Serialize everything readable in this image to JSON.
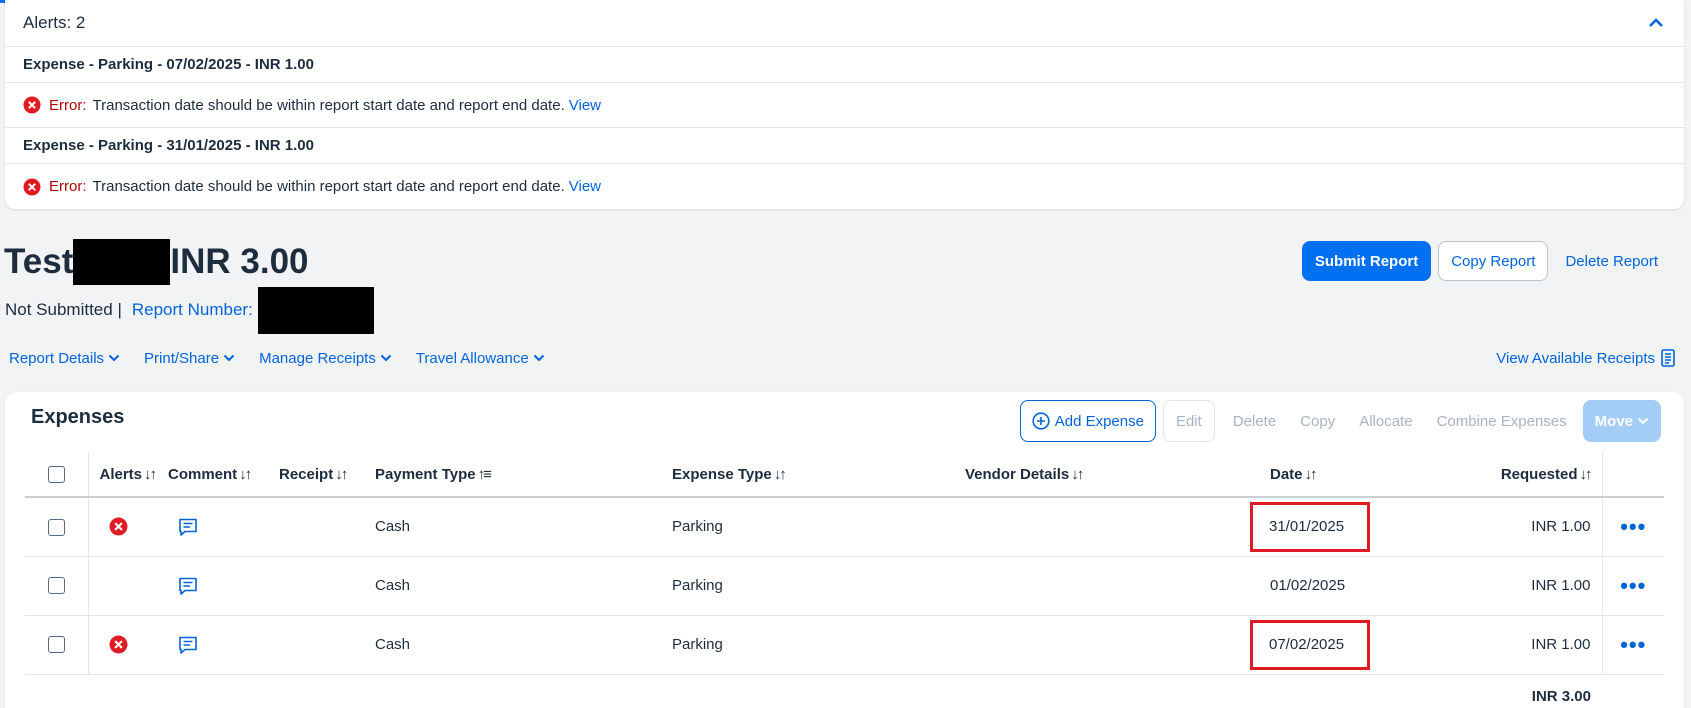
{
  "alerts": {
    "title": "Alerts: 2",
    "items": [
      {
        "expense": "Expense - Parking - 07/02/2025 - INR 1.00",
        "error_label": "Error:",
        "message": "Transaction date should be within report start date and report end date.",
        "link": "View"
      },
      {
        "expense": "Expense - Parking - 31/01/2025 - INR 1.00",
        "error_label": "Error:",
        "message": "Transaction date should be within report start date and report end date.",
        "link": "View"
      }
    ]
  },
  "report": {
    "title_prefix": "Test",
    "amount": "INR 3.00",
    "status": "Not Submitted |",
    "number_label": "Report Number:",
    "buttons": {
      "submit": "Submit Report",
      "copy": "Copy Report",
      "delete": "Delete Report"
    }
  },
  "menu": {
    "items": [
      "Report Details",
      "Print/Share",
      "Manage Receipts",
      "Travel Allowance"
    ],
    "view_receipts": "View Available Receipts"
  },
  "expenses": {
    "title": "Expenses",
    "toolbar": {
      "add": "Add Expense",
      "edit": "Edit",
      "delete": "Delete",
      "copy": "Copy",
      "allocate": "Allocate",
      "combine": "Combine Expenses",
      "move": "Move"
    },
    "columns": {
      "alerts": "Alerts",
      "comment": "Comment",
      "receipt": "Receipt",
      "payment_type": "Payment Type",
      "expense_type": "Expense Type",
      "vendor": "Vendor Details",
      "date": "Date",
      "requested": "Requested"
    },
    "rows": [
      {
        "payment_type": "Cash",
        "expense_type": "Parking",
        "vendor": "",
        "date": "31/01/2025",
        "requested": "INR 1.00"
      },
      {
        "payment_type": "Cash",
        "expense_type": "Parking",
        "vendor": "",
        "date": "01/02/2025",
        "requested": "INR 1.00"
      },
      {
        "payment_type": "Cash",
        "expense_type": "Parking",
        "vendor": "",
        "date": "07/02/2025",
        "requested": "INR 1.00"
      }
    ],
    "total": "INR 3.00"
  },
  "colors": {
    "accent": "#0070f2",
    "link": "#0064d9",
    "error": "#e01b24",
    "error_text": "#aa0808"
  }
}
